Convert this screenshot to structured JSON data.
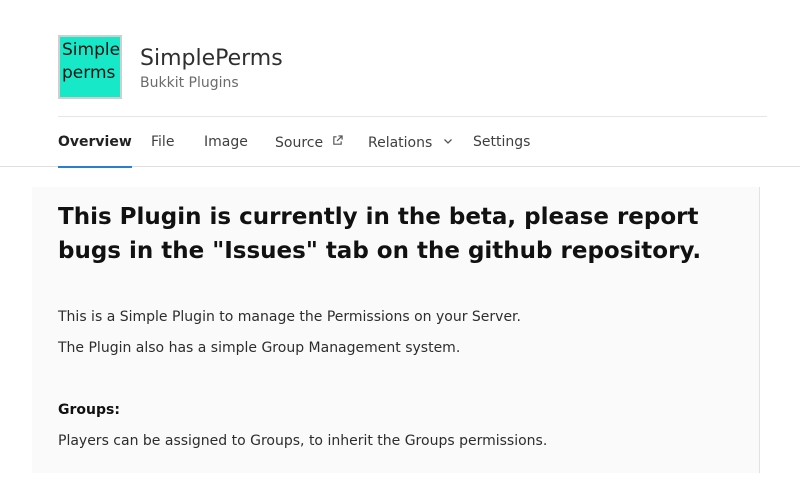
{
  "project": {
    "logo_lines": [
      "Simple",
      "perms"
    ],
    "title": "SimplePerms",
    "category": "Bukkit Plugins",
    "logo_color": "#17e8c8"
  },
  "tabs": [
    {
      "label": "Overview",
      "active": true
    },
    {
      "label": "File",
      "active": false
    },
    {
      "label": "Image",
      "active": false
    },
    {
      "label": "Source",
      "active": false,
      "icon": "external-link-icon"
    },
    {
      "label": "Relations",
      "active": false,
      "icon": "chevron-down-icon"
    },
    {
      "label": "Settings",
      "active": false
    }
  ],
  "accent_color": "#2a7fd4",
  "description": {
    "headline": "This Plugin is currently in the beta, please report bugs in the \"Issues\" tab on the github repository.",
    "paragraphs": [
      "This is a Simple Plugin to manage the Permissions on your Server.",
      "The Plugin also has a simple Group Management system."
    ],
    "groups_heading": "Groups:",
    "groups_text": "Players can be assigned to Groups, to inherit the Groups permissions."
  }
}
